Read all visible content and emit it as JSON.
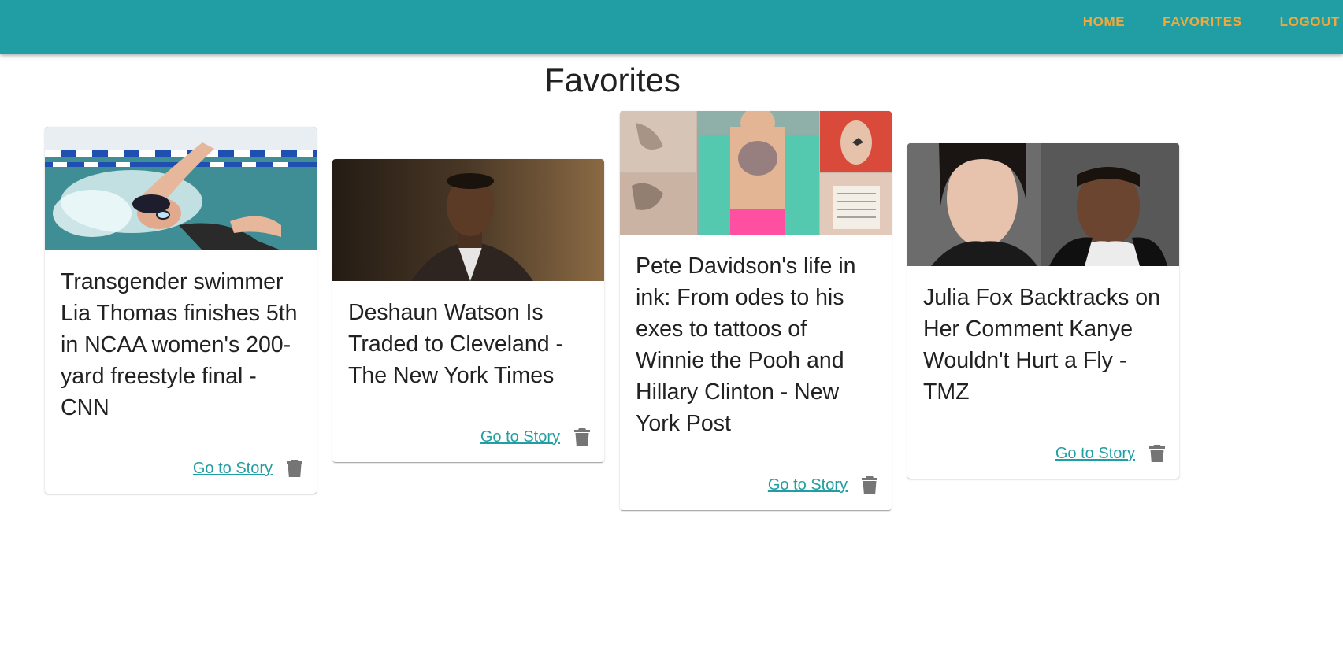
{
  "nav": {
    "home": "HOME",
    "favorites": "FAVORITES",
    "logout": "LOGOUT"
  },
  "page": {
    "title": "Favorites"
  },
  "cards": [
    {
      "title": "Transgender swimmer Lia Thomas finishes 5th in NCAA women's 200-yard freestyle final - CNN",
      "link_label": "Go to Story",
      "image": "swimmer-photo"
    },
    {
      "title": "Deshaun Watson Is Traded to Cleveland - The New York Times",
      "link_label": "Go to Story",
      "image": "man-in-suit-photo"
    },
    {
      "title": "Pete Davidson's life in ink: From odes to his exes to tattoos of Winnie the Pooh and Hillary Clinton - New York Post",
      "link_label": "Go to Story",
      "image": "tattoo-collage-photo"
    },
    {
      "title": "Julia Fox Backtracks on Her Comment Kanye Wouldn't Hurt a Fly - TMZ",
      "link_label": "Go to Story",
      "image": "couple-photo"
    }
  ],
  "colors": {
    "appbar": "#219ea3",
    "nav_text": "#f2a93b",
    "link": "#219ea3",
    "icon": "#757575"
  },
  "icons": {
    "delete": "trash-icon"
  }
}
